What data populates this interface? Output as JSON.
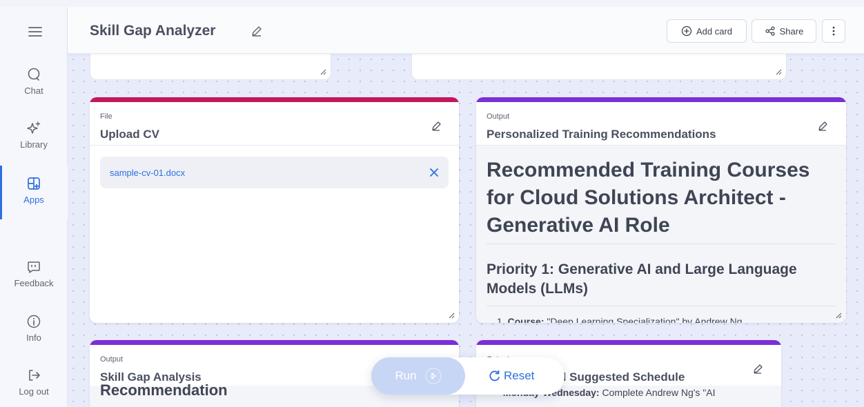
{
  "header": {
    "app_title": "Skill Gap Analyzer",
    "add_card_label": "Add card",
    "share_label": "Share"
  },
  "sidebar": {
    "items": [
      {
        "label": "Chat",
        "icon": "chat-icon"
      },
      {
        "label": "Library",
        "icon": "sparkle-icon"
      },
      {
        "label": "Apps",
        "icon": "apps-icon",
        "active": true
      },
      {
        "label": "Feedback",
        "icon": "feedback-icon"
      },
      {
        "label": "Info",
        "icon": "info-icon"
      },
      {
        "label": "Log out",
        "icon": "logout-icon"
      }
    ]
  },
  "cards": {
    "upload": {
      "kind": "File",
      "title": "Upload CV",
      "file_name": "sample-cv-01.docx",
      "accent": "#c2185b"
    },
    "recommendations": {
      "kind": "Output",
      "title": "Personalized Training Recommendations",
      "heading": "Recommended Training Courses for Cloud Solutions Architect - Generative AI Role",
      "subheading": "Priority 1: Generative AI and Large Language Models (LLMs)",
      "list_item_label": "Course:",
      "list_item_text": "\"Deep Learning Specialization\" by Andrew Ng",
      "accent": "#7b2fd6"
    },
    "gap_analysis": {
      "kind": "Output",
      "title": "Skill Gap Analysis",
      "partial_text": "Recommendation",
      "accent": "#7b2fd6"
    },
    "schedule": {
      "kind": "Output",
      "title": "d Suggested Schedule",
      "bullet_label": "Monday-Wednesday:",
      "bullet_text": " Complete Andrew Ng's \"AI",
      "accent": "#7b2fd6"
    }
  },
  "run_bar": {
    "run_label": "Run",
    "reset_label": "Reset"
  },
  "colors": {
    "active_blue": "#2d6fe0",
    "file_accent": "#c2185b",
    "output_accent": "#7b2fd6"
  }
}
